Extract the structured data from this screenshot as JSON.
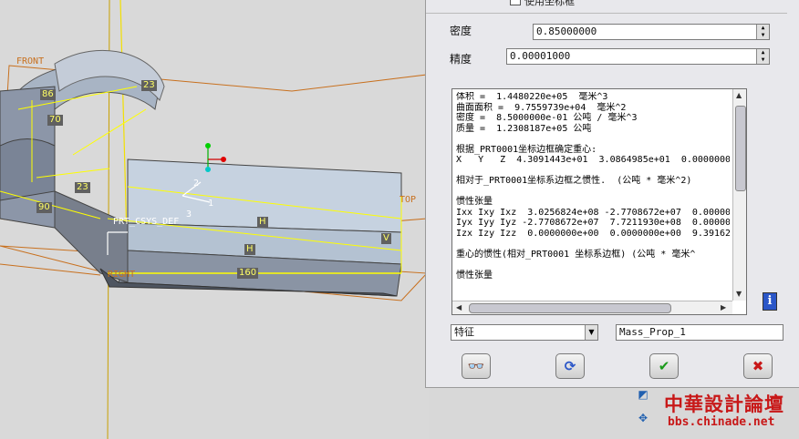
{
  "panel": {
    "top_option": "使用坐标框",
    "density_label": "密度",
    "density_value": "0.85000000",
    "precision_label": "精度",
    "precision_value": "0.00001000",
    "results_lines": [
      "体积 =  1.4480220e+05  毫米^3",
      "曲面面积 =  9.7559739e+04  毫米^2",
      "密度 =  8.5000000e-01 公吨 / 毫米^3",
      "质量 =  1.2308187e+05 公吨",
      "",
      "根据_PRT0001坐标边框确定重心:",
      "X   Y   Z  4.3091443e+01  3.0864985e+01  0.0000000",
      "",
      "相对于_PRT0001坐标系边框之惯性.  (公吨 * 毫米^2)",
      "",
      "惯性张量",
      "Ixx Ixy Ixz  3.0256824e+08 -2.7708672e+07  0.00000",
      "Iyx Iyy Iyz -2.7708672e+07  7.7211930e+08  0.00000",
      "Izx Izy Izz  0.0000000e+00  0.0000000e+00  9.39162",
      "",
      "重心的惯性(相对_PRT0001 坐标系边框) (公吨 * 毫米^",
      "",
      "惯性张量"
    ],
    "feature_select": "特征",
    "feature_name": "Mass_Prop_1",
    "info_label": "i"
  },
  "buttons": {
    "preview": "👓",
    "repeat": "⟳",
    "ok": "✔",
    "cancel": "✖"
  },
  "model_view": {
    "front_label": "FRONT",
    "top_label": "TOP",
    "right_label": "RIGHT",
    "csys_label": "PRT_CSYS_DEF",
    "dims": [
      "86",
      "70",
      "23",
      "90",
      "23",
      "160",
      "H",
      "H",
      "V",
      "1",
      "2",
      "3"
    ]
  },
  "watermark": {
    "line1": "中華設計論壇",
    "line2": "bbs.chinade.net"
  },
  "colors": {
    "accent_yellow": "#ffff00",
    "datum_orange": "#c8701e",
    "ok_green": "#1a9a1a",
    "cancel_red": "#c81818",
    "info_blue": "#2a56c8"
  }
}
